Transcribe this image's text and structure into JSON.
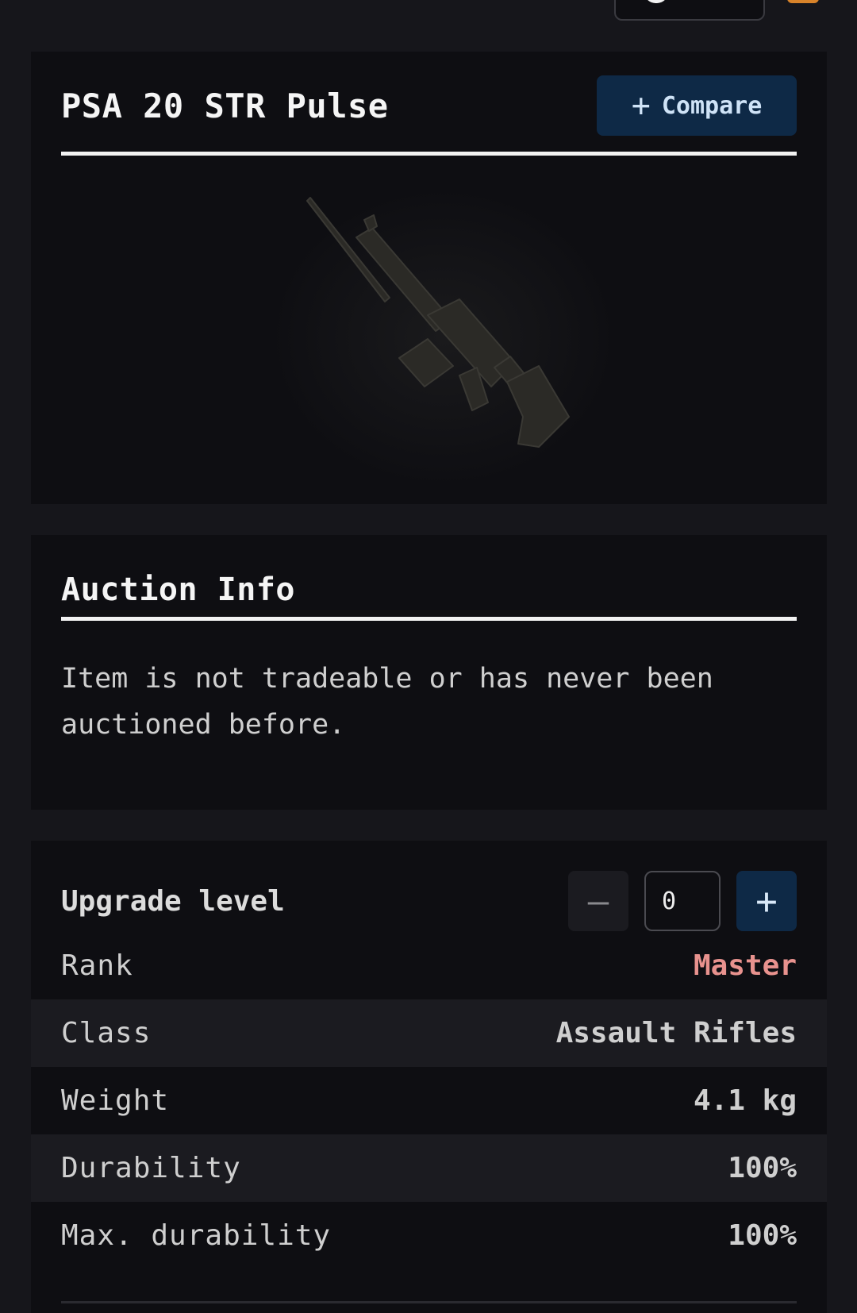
{
  "item": {
    "name": "PSA 20 STR Pulse",
    "compare_label": "Compare",
    "image_alt": "PSA 20 STR Pulse rifle"
  },
  "auction": {
    "heading": "Auction Info",
    "message": "Item is not tradeable or has never been auctioned before."
  },
  "upgrade": {
    "label": "Upgrade level",
    "minus_symbol": "—",
    "value": "0",
    "plus_symbol": "+"
  },
  "stats": [
    {
      "label": "Rank",
      "value": "Master"
    },
    {
      "label": "Class",
      "value": "Assault Rifles"
    },
    {
      "label": "Weight",
      "value": "4.1 kg"
    },
    {
      "label": "Durability",
      "value": "100%"
    },
    {
      "label": "Max. durability",
      "value": "100%"
    }
  ],
  "colors": {
    "background": "#16161b",
    "card": "#0e0e12",
    "accent_button": "#0e2946",
    "rank_master": "#e8928e"
  }
}
